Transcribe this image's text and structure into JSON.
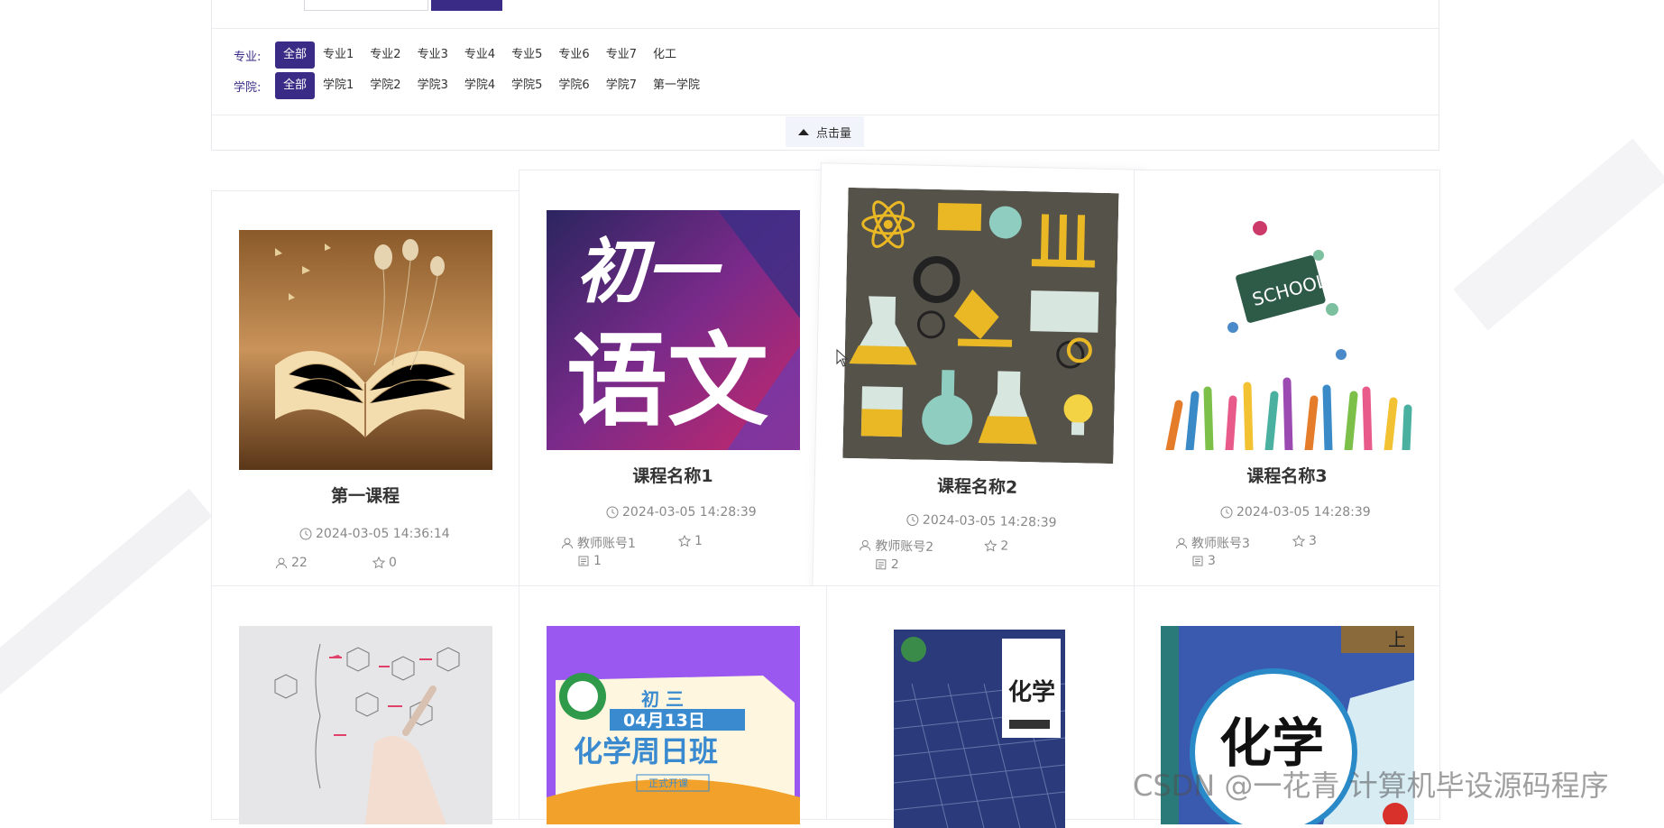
{
  "filters": {
    "major": {
      "label": "专业:",
      "options": [
        "全部",
        "专业1",
        "专业2",
        "专业3",
        "专业4",
        "专业5",
        "专业6",
        "专业7",
        "化工"
      ],
      "active_index": 0
    },
    "college": {
      "label": "学院:",
      "options": [
        "全部",
        "学院1",
        "学院2",
        "学院3",
        "学院4",
        "学院5",
        "学院6",
        "学院7",
        "第一学院"
      ],
      "active_index": 0
    },
    "sort_label": "点击量"
  },
  "courses": [
    {
      "title": "第一课程",
      "time": "2024-03-05 14:36:14",
      "views": "22",
      "stars": "0",
      "image": "open-book"
    },
    {
      "title": "课程名称1",
      "time": "2024-03-05 14:28:39",
      "teacher": "教师账号1",
      "stars": "1",
      "comments": "1",
      "image": "chinese-poster",
      "poster_line1": "初一",
      "poster_line2": "语文"
    },
    {
      "title": "课程名称2",
      "time": "2024-03-05 14:28:39",
      "teacher": "教师账号2",
      "stars": "2",
      "comments": "2",
      "image": "science-icons"
    },
    {
      "title": "课程名称3",
      "time": "2024-03-05 14:28:39",
      "teacher": "教师账号3",
      "stars": "3",
      "comments": "3",
      "image": "school-hands",
      "school_text": "SCHOOL"
    },
    {
      "image": "chemistry-formula"
    },
    {
      "image": "chemistry-poster",
      "poster_top": "初 三",
      "poster_date": "04月13日",
      "poster_main": "化学周日班",
      "poster_tag": "正式开课"
    },
    {
      "image": "chemistry-book-1",
      "book_title": "化学"
    },
    {
      "image": "chemistry-book-2",
      "book_title": "化学",
      "corner_text": "上"
    }
  ],
  "watermark": "CSDN @一花青  计算机毕设源码程序",
  "colors": {
    "primary": "#3a2c86",
    "sort_bg": "#f1f5fb"
  }
}
